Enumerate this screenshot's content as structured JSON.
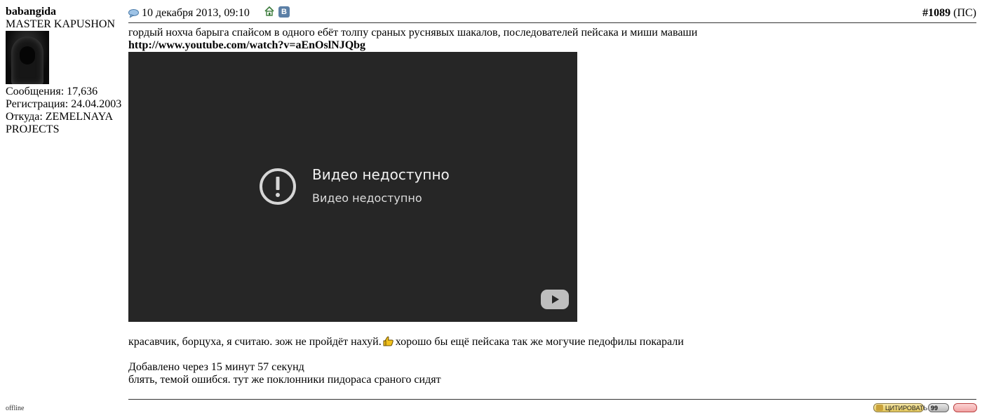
{
  "author": {
    "username": "babangida",
    "rank": "MASTER KAPUSHON",
    "posts": "Сообщения: 17,636",
    "registered": "Регистрация: 24.04.2003",
    "location": "Откуда: ZEMELNAYA PROJECTS",
    "status": "offline"
  },
  "post": {
    "date": "10 декабря 2013, 09:10",
    "number": "#1089",
    "number_suffix": "(ПС)",
    "vk_label": "В",
    "text1": "гордый нохча барыга спайсом в одного ебёт толпу сраных руснявых шакалов, последователей пейсака и миши маваши",
    "link": "http://www.youtube.com/watch?v=aEnOslNJQbg",
    "text2_before": "красавчик, борцуха, я считаю. зож не пройдёт нахуй.",
    "text2_after": "хорошо бы ещё пейсака так же могучие педофилы покарали",
    "added": "Добавлено через 15 минут 57 секунд",
    "text3": "блять, темой ошибся. тут же поклонники пидораса сраного сидят"
  },
  "video": {
    "title": "Видео недоступно",
    "subtitle": "Видео недоступно"
  },
  "buttons": {
    "quote": "ЦИТИРОВАТЬ",
    "multiquote": "99"
  },
  "icons": {
    "post": "speech-bubble-icon",
    "home": "home-icon",
    "vk": "vk-icon",
    "smiley": "thumbs-up-smiley-icon",
    "warning": "exclamation-circle-icon",
    "play": "youtube-play-icon"
  },
  "colors": {
    "vk": "#5b7fa6",
    "video_bg": "#262626",
    "home": "#3a7a3a"
  }
}
